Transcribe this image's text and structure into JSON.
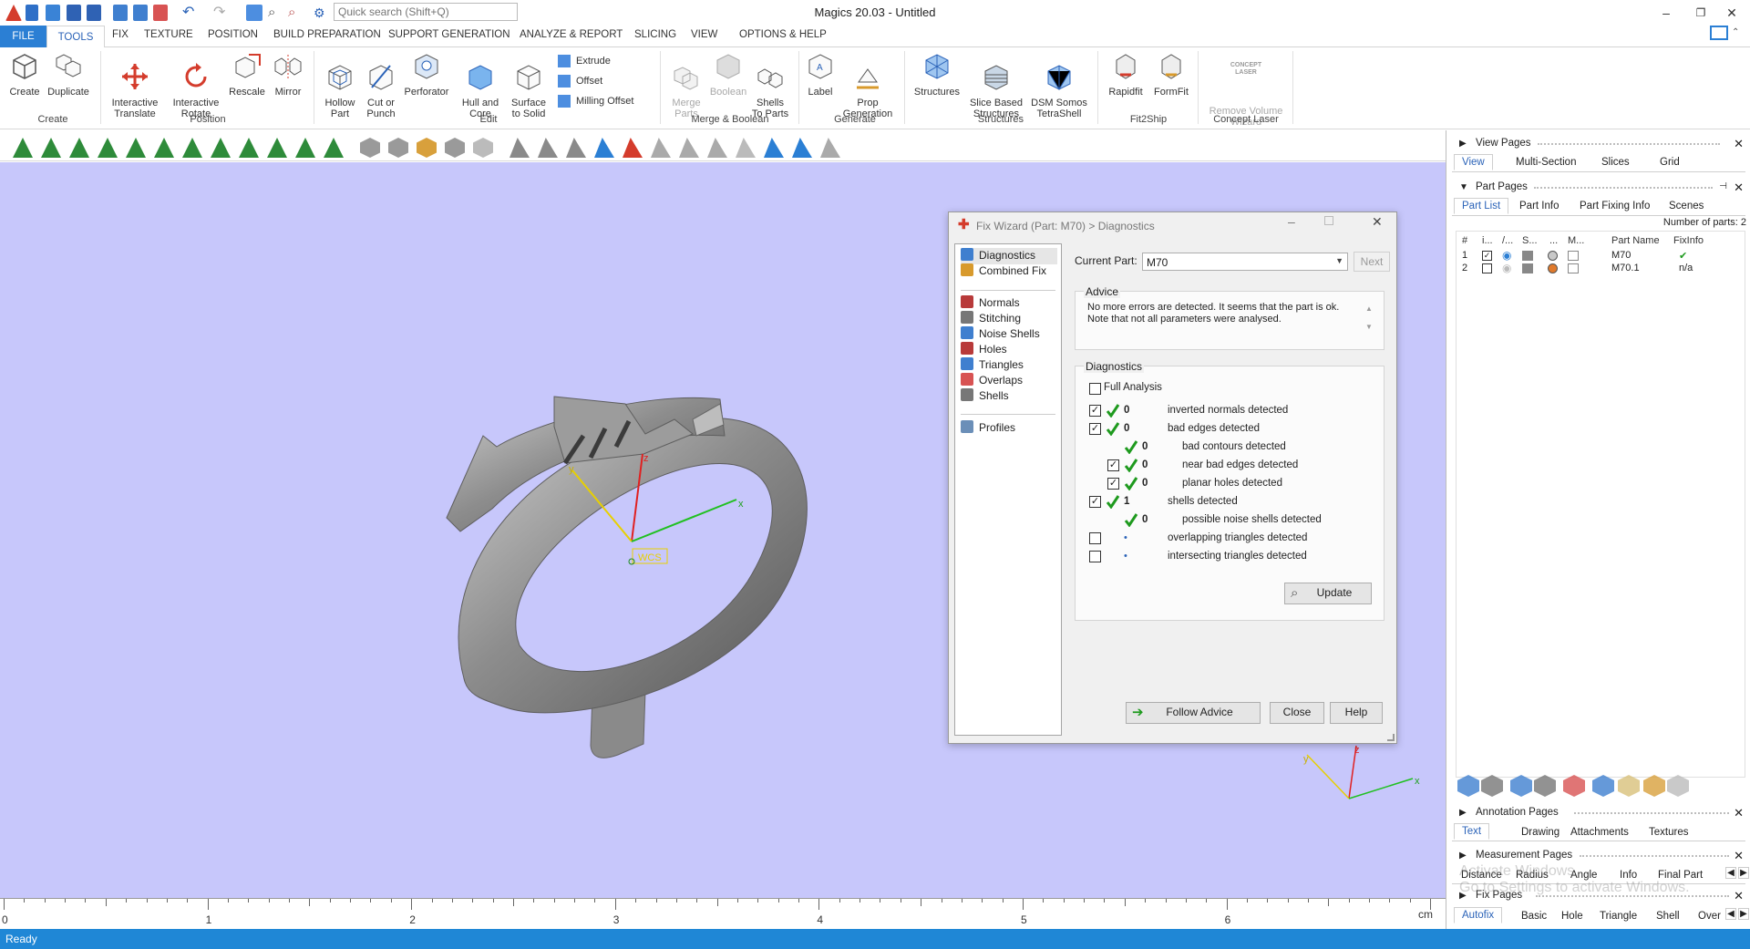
{
  "window": {
    "title": "Magics 20.03 - Untitled",
    "search_placeholder": "Quick search (Shift+Q)",
    "min": "–",
    "max": "❐",
    "close": "✕"
  },
  "menu_tabs": [
    "FILE",
    "TOOLS",
    "FIX",
    "TEXTURE",
    "POSITION",
    "BUILD PREPARATION",
    "SUPPORT GENERATION",
    "ANALYZE & REPORT",
    "SLICING",
    "VIEW",
    "OPTIONS & HELP"
  ],
  "ribbon": {
    "create": "Create",
    "duplicate": "Duplicate",
    "group_create": "Create",
    "interactive_translate": "Interactive\nTranslate",
    "interactive_rotate": "Interactive\nRotate",
    "rescale": "Rescale",
    "mirror": "Mirror",
    "group_position": "Position",
    "hollow_part": "Hollow\nPart",
    "cut_or_punch": "Cut or\nPunch",
    "perforator": "Perforator",
    "hull_and_core": "Hull and\nCore",
    "surface_to_solid": "Surface\nto Solid",
    "extrude": "Extrude",
    "offset": "Offset",
    "milling_offset": "Milling Offset",
    "group_edit": "Edit",
    "merge_parts": "Merge\nParts",
    "boolean": "Boolean",
    "shells_to_parts": "Shells\nTo Parts",
    "group_merge": "Merge & Boolean",
    "label": "Label",
    "prop_generation": "Prop\nGeneration",
    "group_generate": "Generate",
    "structures": "Structures",
    "slice_based_structures": "Slice Based\nStructures",
    "dsm_somos": "DSM Somos\nTetraShell",
    "group_structures": "Structures",
    "rapidfit": "Rapidfit",
    "formfit": "FormFit",
    "group_fit2ship": "Fit2Ship",
    "concept_laser_logo": "CONCEPT\nLASER",
    "remove_volume_wizard": "Remove Volume\nWizard",
    "group_concept_laser": "Concept Laser"
  },
  "viewport": {
    "wcs_label": "WCS",
    "axis_x": "x",
    "axis_y": "y",
    "axis_z": "z",
    "ruler_ticks": [
      "0",
      "1",
      "2",
      "3",
      "4",
      "5",
      "6"
    ],
    "ruler_unit": "cm"
  },
  "status": {
    "text": "Ready"
  },
  "dialog": {
    "title": "Fix Wizard (Part: M70) > Diagnostics",
    "nav": [
      "Diagnostics",
      "Combined Fix",
      "Normals",
      "Stitching",
      "Noise Shells",
      "Holes",
      "Triangles",
      "Overlaps",
      "Shells",
      "Profiles"
    ],
    "current_part_label": "Current Part:",
    "current_part_value": "M70",
    "next_label": "Next",
    "advice_title": "Advice",
    "advice_text": "No more errors are detected. It seems that the part is ok.\nNote that not all parameters were analysed.",
    "diagnostics_title": "Diagnostics",
    "full_analysis": "Full Analysis",
    "rows": [
      {
        "count": "0",
        "label": "inverted normals detected"
      },
      {
        "count": "0",
        "label": "bad edges detected"
      },
      {
        "count": "0",
        "label": "bad contours detected"
      },
      {
        "count": "0",
        "label": "near bad edges detected"
      },
      {
        "count": "0",
        "label": "planar holes detected"
      },
      {
        "count": "1",
        "label": "shells detected"
      },
      {
        "count": "0",
        "label": "possible noise shells detected"
      },
      {
        "count": "•",
        "label": "overlapping triangles detected"
      },
      {
        "count": "•",
        "label": "intersecting triangles detected"
      }
    ],
    "update": "Update",
    "follow_advice": "Follow Advice",
    "close": "Close",
    "help": "Help"
  },
  "right_panel": {
    "view_pages": "View Pages",
    "view_tabs": [
      "View",
      "Multi-Section",
      "Slices",
      "Grid"
    ],
    "part_pages": "Part Pages",
    "part_tabs": [
      "Part List",
      "Part Info",
      "Part Fixing Info",
      "Scenes"
    ],
    "number_of_parts": "Number of parts: 2",
    "columns": [
      "#",
      "i...",
      "/...",
      "S...",
      "...",
      "M...",
      "Part Name",
      "FixInfo"
    ],
    "parts": [
      {
        "num": "1",
        "name": "M70",
        "fixinfo": "✔"
      },
      {
        "num": "2",
        "name": "M70.1",
        "fixinfo": "n/a"
      }
    ],
    "annotation_pages": "Annotation Pages",
    "annotation_tabs": [
      "Text",
      "Drawing",
      "Attachments",
      "Textures"
    ],
    "measurement_pages": "Measurement Pages",
    "measurement_tabs": [
      "Distance",
      "Radius",
      "Angle",
      "Info",
      "Final Part"
    ],
    "fix_pages": "Fix Pages",
    "fix_tabs": [
      "Autofix",
      "Basic",
      "Hole",
      "Triangle",
      "Shell",
      "Over"
    ],
    "watermark": "Activate Windows\nGo to Settings to activate Windows."
  },
  "colors": {
    "accent": "#2b7fd4",
    "viewport_bg": "#c7c7fb",
    "check_green": "#1e9a1e"
  }
}
